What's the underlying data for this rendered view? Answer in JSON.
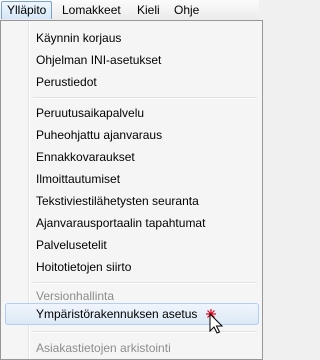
{
  "menubar": [
    "Ylläpito",
    "Lomakkeet",
    "Kieli",
    "Ohje"
  ],
  "menu": {
    "group1": [
      "Käynnin korjaus",
      "Ohjelman INI-asetukset",
      "Perustiedot"
    ],
    "group2": [
      "Peruutusaikapalvelu",
      "Puheohjattu ajanvaraus",
      "Ennakkovaraukset",
      "Ilmoittautumiset",
      "Tekstiviestilähetysten seuranta",
      "Ajanvarausportaalin tapahtumat",
      "Palvelusetelit",
      "Hoitotietojen siirto"
    ],
    "version_heading": "Versionhallinta",
    "highlighted": "Ympäristörakennuksen asetus",
    "cut_off": "Asiakastietojen arkistointi"
  },
  "colors": {
    "highlight_border": "#aecff7",
    "disabled_text": "#8d8d8d",
    "cursor_spark": "#e8001c"
  }
}
